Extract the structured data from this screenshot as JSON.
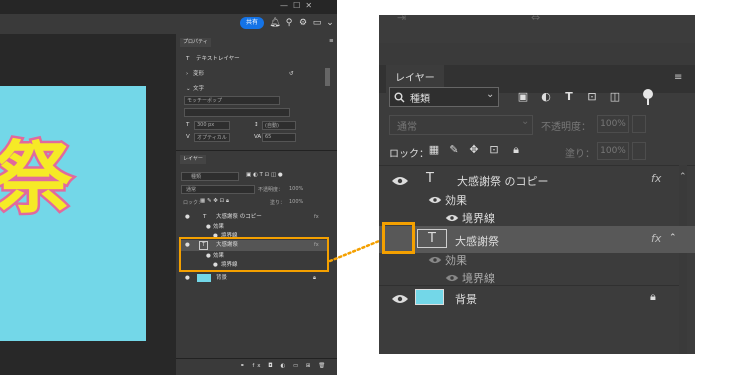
{
  "left_screenshot": {
    "share_button": "共有",
    "properties_tab": "プロパティ",
    "text_layer_type": "テキストレイヤー",
    "section_transform": "変形",
    "section_text": "文字",
    "font_family": "モッチーポップ",
    "font_size": "300 px",
    "leading": "(自動)",
    "tracking_mode": "オプティカル",
    "kerning": "65",
    "layers_tab": "レイヤー",
    "filter_kind": "種類",
    "blend_mode": "通常",
    "opacity_label": "不透明度：",
    "opacity_value": "100%",
    "lock_label": "ロック：",
    "fill_label": "塗り：",
    "fill_value": "100%",
    "layers": [
      {
        "name": "大感謝祭 のコピー",
        "fx": "fx"
      },
      {
        "name": "効果"
      },
      {
        "name": "境界線"
      },
      {
        "name": "大感謝祭",
        "fx": "fx"
      },
      {
        "name": "効果"
      },
      {
        "name": "境界線"
      },
      {
        "name": "背景"
      }
    ],
    "canvas_text": "祭",
    "canvas_bg_color": "#73d7e8",
    "canvas_text_color": "#f6ea26",
    "canvas_stroke_color": "#e06a9e"
  },
  "zoom_panel": {
    "tab_label": "レイヤー",
    "filter_kind": "種類",
    "blend_mode": "通常",
    "opacity_label": "不透明度：",
    "opacity_value": "100%",
    "lock_label": "ロック：",
    "fill_label": "塗り：",
    "fill_value": "100%",
    "layers": [
      {
        "name": "大感謝祭 のコピー",
        "type_icon": "T",
        "fx": "fx",
        "visible": true
      },
      {
        "name": "効果"
      },
      {
        "name": "境界線"
      },
      {
        "name": "大感謝祭",
        "type_icon": "T",
        "fx": "fx",
        "visible": false,
        "selected": true
      },
      {
        "name": "効果"
      },
      {
        "name": "境界線"
      },
      {
        "name": "背景",
        "visible": true,
        "locked": true
      }
    ]
  },
  "colors": {
    "highlight": "#f4a000",
    "thumb_color": "#73d7e8"
  }
}
